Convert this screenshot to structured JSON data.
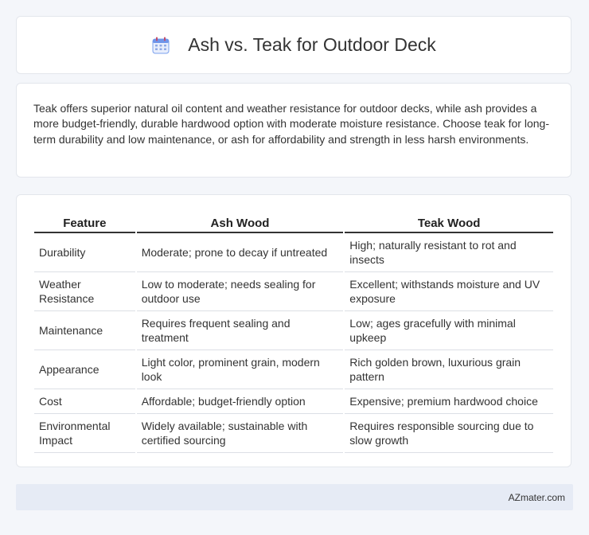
{
  "header": {
    "title": "Ash vs. Teak for Outdoor Deck",
    "icon": "calendar-icon"
  },
  "summary": {
    "text": "Teak offers superior natural oil content and weather resistance for outdoor decks, while ash provides a more budget-friendly, durable hardwood option with moderate moisture resistance. Choose teak for long-term durability and low maintenance, or ash for affordability and strength in less harsh environments."
  },
  "table": {
    "headers": [
      "Feature",
      "Ash Wood",
      "Teak Wood"
    ],
    "rows": [
      [
        "Durability",
        "Moderate; prone to decay if untreated",
        "High; naturally resistant to rot and insects"
      ],
      [
        "Weather Resistance",
        "Low to moderate; needs sealing for outdoor use",
        "Excellent; withstands moisture and UV exposure"
      ],
      [
        "Maintenance",
        "Requires frequent sealing and treatment",
        "Low; ages gracefully with minimal upkeep"
      ],
      [
        "Appearance",
        "Light color, prominent grain, modern look",
        "Rich golden brown, luxurious grain pattern"
      ],
      [
        "Cost",
        "Affordable; budget-friendly option",
        "Expensive; premium hardwood choice"
      ],
      [
        "Environmental Impact",
        "Widely available; sustainable with certified sourcing",
        "Requires responsible sourcing due to slow growth"
      ]
    ]
  },
  "footer": {
    "brand": "AZmater.com"
  },
  "colors": {
    "accent": "#5b8def",
    "background": "#f4f6fa",
    "footer_bg": "#e6ebf5"
  }
}
